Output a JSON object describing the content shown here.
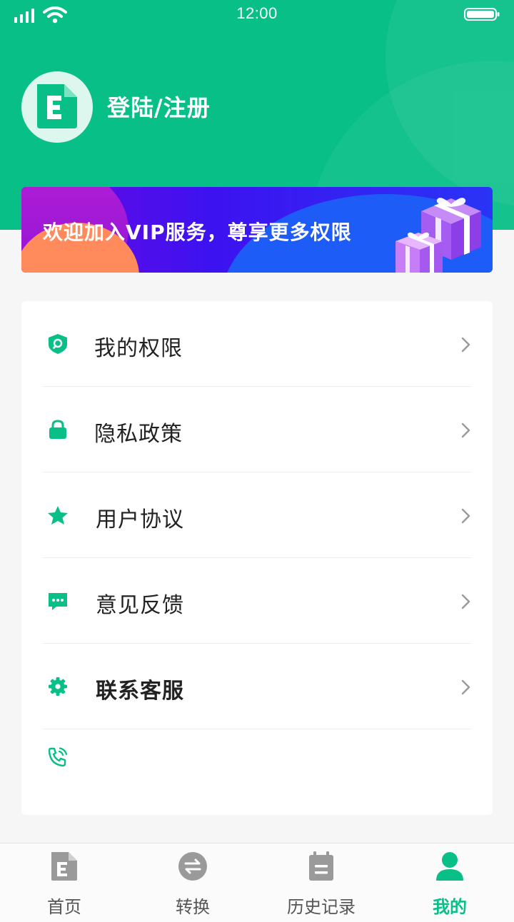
{
  "status_bar": {
    "time": "12:00"
  },
  "profile": {
    "login_label": "登陆/注册",
    "avatar_icon": "document-e-icon"
  },
  "vip_banner": {
    "text": "欢迎加入VIP服务，尊享更多权限"
  },
  "menu": {
    "items": [
      {
        "label": "我的权限",
        "icon": "shield-search-icon"
      },
      {
        "label": "隐私政策",
        "icon": "lock-icon"
      },
      {
        "label": "用户协议",
        "icon": "star-icon"
      },
      {
        "label": "意见反馈",
        "icon": "message-icon"
      },
      {
        "label": "联系客服",
        "icon": "gear-icon"
      },
      {
        "label": "",
        "icon": "phone-call-icon"
      }
    ]
  },
  "tabs": [
    {
      "label": "首页",
      "icon": "document-e-icon",
      "active": false
    },
    {
      "label": "转换",
      "icon": "convert-icon",
      "active": false
    },
    {
      "label": "历史记录",
      "icon": "calendar-icon",
      "active": false
    },
    {
      "label": "我的",
      "icon": "user-icon",
      "active": true
    }
  ],
  "colors": {
    "primary": "#08bf87",
    "tab_inactive": "#9a9a9a",
    "vip_blue": "#2a34f5",
    "vip_purple": "#6d08e3"
  }
}
